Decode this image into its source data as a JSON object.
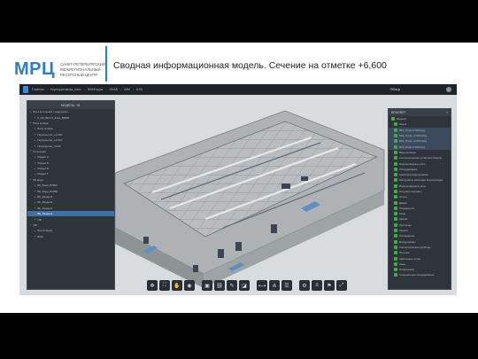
{
  "slide": {
    "logo": "МРЦ",
    "logo_text": "Санкт-Петербургский межрегиональный ресурсный центр",
    "title": "Сводная информационная модель. Сечение на отметке +6,600"
  },
  "app": {
    "breadcrumbs": [
      "Главная",
      "Корпоративная_папк",
      "BIMФорум",
      "ОКАБ",
      "BIM",
      "6.00"
    ],
    "review_label": "Обзор",
    "left_panel": {
      "header": "МОДЕЛЬ: +6.",
      "items": [
        {
          "label": "Блок котельной с водогрейн...",
          "level": 0
        },
        {
          "label": "5_AR_BR-01_Блок_ВВВВ",
          "level": 1
        },
        {
          "label": "Блок склада",
          "level": 0
        },
        {
          "label": "Блок склада",
          "level": 1
        },
        {
          "label": "Перекрытие_+4,200",
          "level": 1
        },
        {
          "label": "Перекрытие_+4,500",
          "level": 1
        },
        {
          "label": "Перекрытие_0,000",
          "level": 1
        },
        {
          "label": "Котельная",
          "level": 0
        },
        {
          "label": "Раздел А",
          "level": 1
        },
        {
          "label": "Раздел Б",
          "level": 1
        },
        {
          "label": "Раздел В",
          "level": 1
        },
        {
          "label": "Раздел Г",
          "level": 1
        },
        {
          "label": "ВК вода",
          "level": 0
        },
        {
          "label": "ВК_Вода_ВОВО",
          "level": 1
        },
        {
          "label": "ВК_Вода_ВОВВ",
          "level": 1
        },
        {
          "label": "ВК_Раздел1",
          "level": 1
        },
        {
          "label": "ВК_Раздел2",
          "level": 1
        },
        {
          "label": "ВК_Раздел3",
          "level": 1
        },
        {
          "label": "ВК_Раздел4",
          "level": 1
        },
        {
          "label": "ОВ",
          "level": 1
        },
        {
          "label": "ОВ",
          "level": 0
        },
        {
          "label": "Вентиляция",
          "level": 1
        },
        {
          "label": "ВОО",
          "level": 1
        }
      ],
      "selected_index": 18
    },
    "right_panel": {
      "header": "БРАУЗЕР",
      "items": [
        "Модели",
        "Лента",
        "ВК1_План 0.000.dwg",
        "ВК1_План +3.000.dwg",
        "ВК2_План +3.000.dwg",
        "ВК2_План 0.000.dwg",
        "Водопроводы",
        "Сантехнические установки водопр.",
        "Водопроводные сети",
        "Оборудование",
        "Арматура водопровода",
        "Материалы изоляции водопровода",
        "Водопроводные узлы",
        "Несущие колонны",
        "Стены",
        "Двери",
        "Перекрытия",
        "Окна",
        "Каркас",
        "Лестницы",
        "Крыши",
        "Ограждения",
        "Воздуховоды",
        "Сантехнические приборы",
        "Потолки",
        "Кабельные лотки",
        "Зоны",
        "Помещения",
        "Специальное оборудование"
      ],
      "highlighted": [
        2,
        3,
        4,
        5
      ]
    },
    "toolbar": {
      "buttons": [
        {
          "name": "move-icon",
          "glyph": "✥"
        },
        {
          "name": "fit-icon",
          "glyph": "⛶"
        },
        {
          "name": "hand-icon",
          "glyph": "✋"
        },
        {
          "name": "eye-icon",
          "glyph": "◉"
        },
        {
          "name": "cube-icon",
          "glyph": "▣"
        },
        {
          "name": "link-icon",
          "glyph": "⛓"
        },
        {
          "name": "edit-icon",
          "glyph": "✎"
        },
        {
          "name": "section-icon",
          "glyph": "◪"
        },
        {
          "name": "measure-icon",
          "glyph": "⟷"
        },
        {
          "name": "tree-icon",
          "glyph": "⋔"
        },
        {
          "name": "layers-icon",
          "glyph": "☰"
        },
        {
          "name": "settings-icon",
          "glyph": "⚙"
        },
        {
          "name": "properties-icon",
          "glyph": "≡"
        },
        {
          "name": "bookmark-icon",
          "glyph": "⚑"
        },
        {
          "name": "fullscreen-icon",
          "glyph": "⤢"
        }
      ]
    }
  },
  "colors": {
    "brand": "#2a7fc9",
    "panel_bg": "#2f343b",
    "selected": "#3d6ea8",
    "checkbox": "#3fae49"
  }
}
